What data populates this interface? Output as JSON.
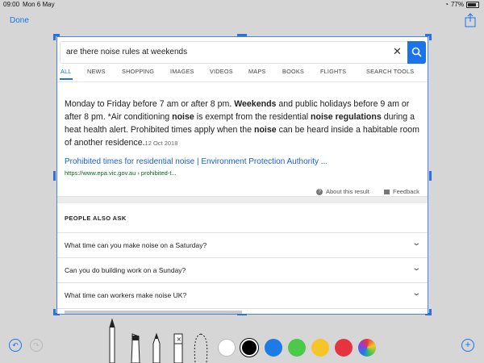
{
  "status": {
    "time": "09:00",
    "date": "Mon 6 May",
    "battery": "77%"
  },
  "nav": {
    "done_label": "Done"
  },
  "search": {
    "query": "are there noise rules at weekends"
  },
  "tabs": [
    {
      "label": "ALL",
      "active": true
    },
    {
      "label": "NEWS"
    },
    {
      "label": "SHOPPING"
    },
    {
      "label": "IMAGES"
    },
    {
      "label": "VIDEOS"
    },
    {
      "label": "MAPS"
    },
    {
      "label": "BOOKS"
    },
    {
      "label": "FLIGHTS"
    },
    {
      "label": "SEARCH TOOLS"
    }
  ],
  "answer": {
    "t1": "Monday to Friday before 7 am or after 8 pm. ",
    "b1": "Weekends",
    "t2": " and public holidays before 9 am or after 8 pm. *Air conditioning ",
    "b2": "noise",
    "t3": " is exempt from the residential ",
    "b3": "noise regulations",
    "t4": " during a heat health alert. Prohibited times apply when the ",
    "b4": "noise",
    "t5": " can be heard inside a habitable room of another residence.",
    "date": "12 Oct 2018",
    "result_title": "Prohibited times for residential noise | Environment Protection Authority ...",
    "result_url": "https://www.epa.vic.gov.au › prohibited-t...",
    "about_label": "About this result",
    "feedback_label": "Feedback"
  },
  "people_also_ask": {
    "title": "PEOPLE ALSO ASK",
    "questions": [
      "What time can you make noise on a Saturday?",
      "Can you do building work on a Sunday?",
      "What time can workers make noise UK?"
    ]
  },
  "colors": {
    "accent": "#1a73e8",
    "swatches": [
      "#ffffff",
      "#000000",
      "#1e7be6",
      "#4cc94a",
      "#f5c52a",
      "#e5343f"
    ]
  }
}
